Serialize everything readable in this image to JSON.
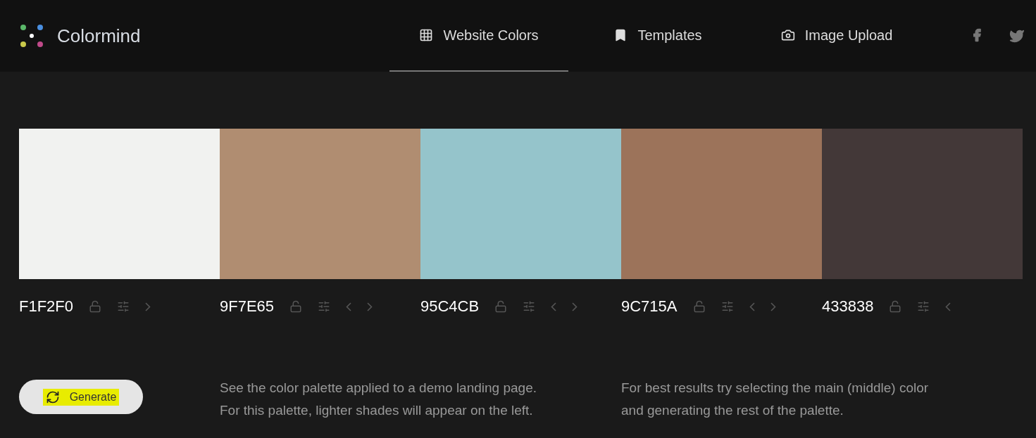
{
  "brand": {
    "name": "Colormind"
  },
  "nav": [
    {
      "label": "Website Colors",
      "selected": true
    },
    {
      "label": "Templates",
      "selected": false
    },
    {
      "label": "Image Upload",
      "selected": false
    }
  ],
  "palette": [
    {
      "label": "F1F2F0",
      "color": "#f1f2f0",
      "prev_arrow": false,
      "next_arrow": true
    },
    {
      "label": "9F7E65",
      "color": "#b08d71",
      "prev_arrow": true,
      "next_arrow": true
    },
    {
      "label": "95C4CB",
      "color": "#95c4cb",
      "prev_arrow": true,
      "next_arrow": true
    },
    {
      "label": "9C715A",
      "color": "#9c735a",
      "prev_arrow": true,
      "next_arrow": true
    },
    {
      "label": "433838",
      "color": "#433838",
      "prev_arrow": true,
      "next_arrow": false
    }
  ],
  "generate_button": {
    "label": "Generate",
    "highlighted": true
  },
  "notes": [
    "See the color palette applied to a demo landing page.\nFor this palette, lighter shades will appear on the left.",
    "For best results try selecting the main (middle) color\nand generating the rest of the palette."
  ]
}
